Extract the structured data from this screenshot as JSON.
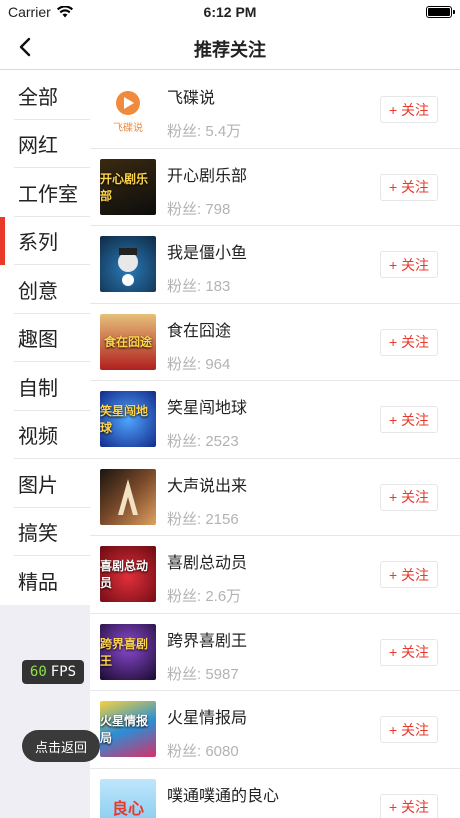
{
  "status_bar": {
    "carrier": "Carrier",
    "time": "6:12 PM"
  },
  "nav": {
    "title": "推荐关注"
  },
  "sidebar": {
    "items": [
      {
        "label": "全部"
      },
      {
        "label": "网红"
      },
      {
        "label": "工作室"
      },
      {
        "label": "系列",
        "active": true
      },
      {
        "label": "创意"
      },
      {
        "label": "趣图"
      },
      {
        "label": "自制"
      },
      {
        "label": "视频"
      },
      {
        "label": "图片"
      },
      {
        "label": "搞笑"
      },
      {
        "label": "精品"
      }
    ]
  },
  "follow_label": "+ 关注",
  "users": [
    {
      "name": "飞碟说",
      "fans": "粉丝: 5.4万",
      "thumb_text": "飞碟说",
      "thumb_color": "#ffffff"
    },
    {
      "name": "开心剧乐部",
      "fans": "粉丝: 798",
      "thumb_text": "开心剧乐部",
      "thumb_color": "#1a1a1a"
    },
    {
      "name": "我是僵小鱼",
      "fans": "粉丝: 183",
      "thumb_text": "",
      "thumb_color": "#1c4f7a"
    },
    {
      "name": "食在囧途",
      "fans": "粉丝: 964",
      "thumb_text": "食在囧途",
      "thumb_color": "#b01f1f"
    },
    {
      "name": "笑星闯地球",
      "fans": "粉丝: 2523",
      "thumb_text": "笑星闯地球",
      "thumb_color": "#1b3fb0"
    },
    {
      "name": "大声说出来",
      "fans": "粉丝: 2156",
      "thumb_text": "",
      "thumb_color": "#3a2a1a"
    },
    {
      "name": "喜剧总动员",
      "fans": "粉丝: 2.6万",
      "thumb_text": "喜剧总动员",
      "thumb_color": "#b8141f"
    },
    {
      "name": "跨界喜剧王",
      "fans": "粉丝: 5987",
      "thumb_text": "跨界喜剧王",
      "thumb_color": "#3a1a5e"
    },
    {
      "name": "火星情报局",
      "fans": "粉丝: 6080",
      "thumb_text": "火星情报局",
      "thumb_color": "#2a8fd6"
    },
    {
      "name": "噗通噗通的良心",
      "fans": "",
      "thumb_text": "良心",
      "thumb_color": "#7cc6ee"
    }
  ],
  "overlay": {
    "fps_value": "60",
    "fps_unit": "FPS",
    "back_label": "点击返回"
  },
  "colors": {
    "accent": "#e8392b",
    "sidebar_bg": "#eeeef4",
    "fans_text": "#b3b3b3"
  },
  "icons": {
    "back": "chevron-left-icon",
    "wifi": "wifi-icon",
    "battery": "battery-icon"
  }
}
